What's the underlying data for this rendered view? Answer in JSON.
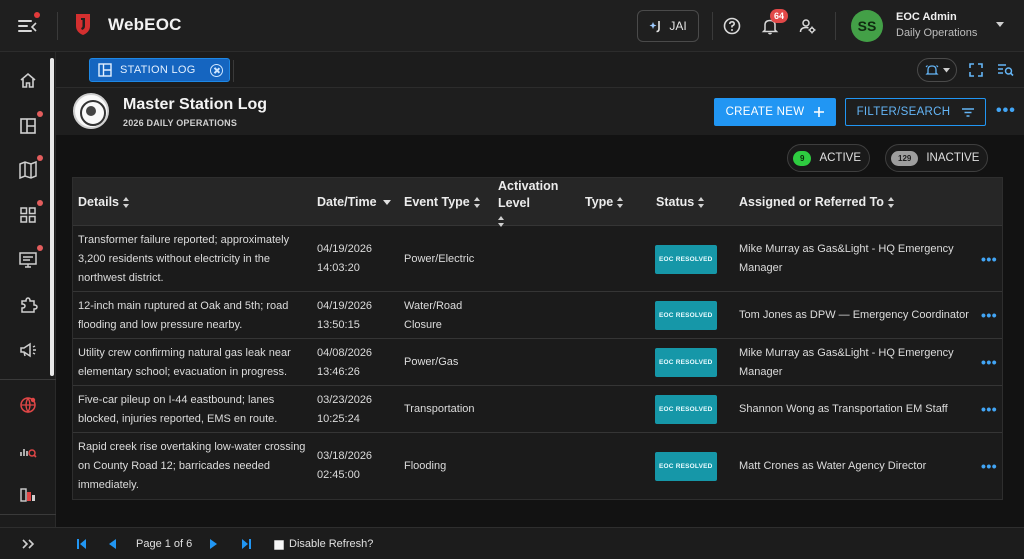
{
  "app": {
    "brand": "WebEOC"
  },
  "topbar": {
    "jai_label": "JAI",
    "notification_count": "64",
    "user": {
      "initials": "SS",
      "name": "EOC Admin",
      "org": "Daily Operations"
    }
  },
  "tab": {
    "label": "STATION LOG"
  },
  "header": {
    "title": "Master Station Log",
    "subtitle": "2026 DAILY OPERATIONS",
    "create_label": "CREATE NEW",
    "filter_label": "FILTER/SEARCH"
  },
  "filters": {
    "active": {
      "count": "9",
      "label": "ACTIVE"
    },
    "inactive": {
      "count": "129",
      "label": "INACTIVE"
    }
  },
  "table": {
    "columns": {
      "details": "Details",
      "datetime": "Date/Time",
      "event_type": "Event Type",
      "activation_level": "Activation Level",
      "type": "Type",
      "status": "Status",
      "assigned": "Assigned or Referred To"
    },
    "rows": [
      {
        "details": "Transformer failure reported; approximately 3,200 residents without electricity in the northwest district.",
        "date": "04/19/2026",
        "time": "14:03:20",
        "event_type": "Power/Electric",
        "status": "EOC RESOLVED",
        "assigned": "Mike Murray as Gas&Light - HQ Emergency Manager"
      },
      {
        "details": "12-inch main ruptured at Oak and 5th; road flooding and low pressure nearby.",
        "date": "04/19/2026",
        "time": "13:50:15",
        "event_type": "Water/Road Closure",
        "status": "EOC RESOLVED",
        "assigned": "Tom Jones as DPW — Emergency Coordinator"
      },
      {
        "details": "Utility crew confirming natural gas leak near elementary school; evacuation in progress.",
        "date": "04/08/2026",
        "time": "13:46:26",
        "event_type": "Power/Gas",
        "status": "EOC RESOLVED",
        "assigned": "Mike Murray as Gas&Light - HQ Emergency Manager"
      },
      {
        "details": "Five-car pileup on I-44 eastbound; lanes blocked, injuries reported, EMS en route.",
        "date": "03/23/2026",
        "time": "10:25:24",
        "event_type": "Transportation",
        "status": "EOC RESOLVED",
        "assigned": "Shannon Wong as Transportation EM Staff"
      },
      {
        "details": "Rapid creek rise overtaking low-water crossing on County Road 12; barricades needed immediately.",
        "date": "03/18/2026",
        "time": "02:45:00",
        "event_type": "Flooding",
        "status": "EOC RESOLVED",
        "assigned": "Matt Crones as Water Agency Director"
      }
    ]
  },
  "footer": {
    "page_text": "Page 1 of 6",
    "disable_refresh": "Disable Refresh?"
  },
  "colors": {
    "accent": "#2196f3",
    "status_resolved": "#1697a8",
    "active_count": "#2ecc40",
    "alert_red": "#e24848"
  }
}
